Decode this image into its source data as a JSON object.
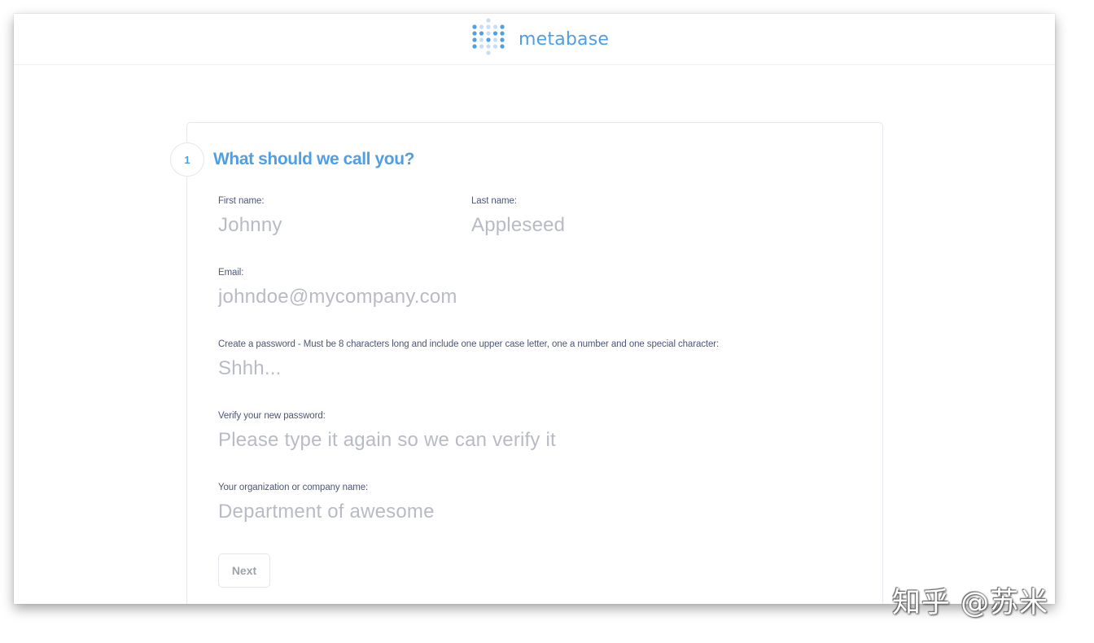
{
  "app": {
    "name": "metabase",
    "logo_icon": "metabase-dots-logo",
    "accent": "#509ee3"
  },
  "step": {
    "number": "1",
    "title": "What should we call you?"
  },
  "form": {
    "first_name": {
      "label": "First name:",
      "placeholder": "Johnny",
      "value": ""
    },
    "last_name": {
      "label": "Last name:",
      "placeholder": "Appleseed",
      "value": ""
    },
    "email": {
      "label": "Email:",
      "placeholder": "johndoe@mycompany.com",
      "value": ""
    },
    "password": {
      "label": "Create a password - Must be 8 characters long and include one upper case letter, one a number and one special character:",
      "placeholder": "Shhh...",
      "value": ""
    },
    "verify_password": {
      "label": "Verify your new password:",
      "placeholder": "Please type it again so we can verify it",
      "value": ""
    },
    "organization": {
      "label": "Your organization or company name:",
      "placeholder": "Department of awesome",
      "value": ""
    },
    "next_label": "Next"
  },
  "watermark": "知乎 @苏米"
}
